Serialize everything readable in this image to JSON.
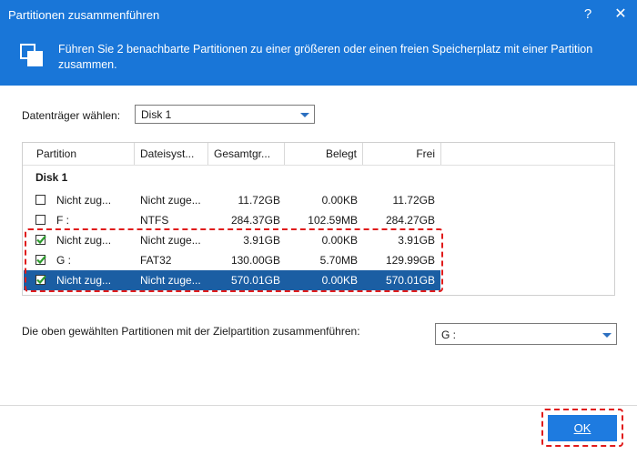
{
  "window": {
    "title": "Partitionen zusammenführen",
    "help_label": "?",
    "close_label": "✕",
    "description": "Führen Sie 2 benachbarte Partitionen zu einer größeren oder einen freien Speicherplatz mit einer Partition zusammen."
  },
  "disk_select": {
    "label": "Datenträger wählen:",
    "value": "Disk 1"
  },
  "table": {
    "columns": [
      "Partition",
      "Dateisyst...",
      "Gesamtgr...",
      "Belegt",
      "Frei"
    ],
    "group": "Disk 1",
    "rows": [
      {
        "partition": "Nicht zug...",
        "fs": "Nicht zuge...",
        "total": "11.72GB",
        "used": "0.00KB",
        "free": "11.72GB",
        "checked": false,
        "selected": false
      },
      {
        "partition": "F :",
        "fs": "NTFS",
        "total": "284.37GB",
        "used": "102.59MB",
        "free": "284.27GB",
        "checked": false,
        "selected": false
      },
      {
        "partition": "Nicht zug...",
        "fs": "Nicht zuge...",
        "total": "3.91GB",
        "used": "0.00KB",
        "free": "3.91GB",
        "checked": true,
        "selected": false
      },
      {
        "partition": "G :",
        "fs": "FAT32",
        "total": "130.00GB",
        "used": "5.70MB",
        "free": "129.99GB",
        "checked": true,
        "selected": false
      },
      {
        "partition": "Nicht zug...",
        "fs": "Nicht zuge...",
        "total": "570.01GB",
        "used": "0.00KB",
        "free": "570.01GB",
        "checked": true,
        "selected": true
      }
    ]
  },
  "target": {
    "label": "Die oben gewählten Partitionen mit der Zielpartition zusammenführen:",
    "value": "G :"
  },
  "ok_button": {
    "label": "OK"
  },
  "colors": {
    "titlebar": "#1976d8",
    "selected_row": "#1b5ea3",
    "ok_button": "#1e7be0",
    "highlight_dash": "#e01b1b",
    "checkmark": "#2e9b2e"
  },
  "icons": {
    "merge": "merge-partitions-icon",
    "dropdown": "chevron-down-icon",
    "checkbox": "checkbox-icon"
  }
}
